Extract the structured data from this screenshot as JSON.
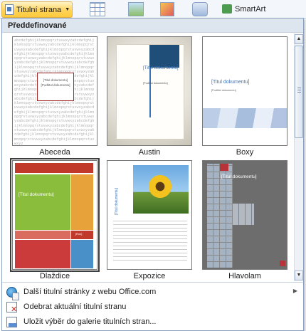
{
  "ribbon": {
    "cover_page_button": "Titulní strana",
    "smartart_label": "SmartArt"
  },
  "gallery": {
    "section_header": "Předdefinované",
    "tiles": [
      {
        "name": "Abeceda",
        "preview_title": "[Titul dokumentu]",
        "preview_sub": "[Podtitul dokumentu]",
        "preview_text": "abcdefghijklmnopqrstuvwxyz"
      },
      {
        "name": "Austin",
        "preview_title": "[Titul dokumentu]",
        "preview_sub": "[Podtitul dokumentu]"
      },
      {
        "name": "Boxy",
        "preview_title": "[Titul dokumentu]",
        "preview_sub": "[Podtitul dokumentu]"
      },
      {
        "name": "Dlaždice",
        "preview_title": "[Titul dokumentu]",
        "preview_year": "[Rok]"
      },
      {
        "name": "Expozice",
        "preview_title": "[Titul dokumentu]"
      },
      {
        "name": "Hlavolam",
        "preview_title": "[Titul dokumentu]"
      }
    ]
  },
  "menu": {
    "items": [
      {
        "label": "Další titulní stránky z webu Office.com",
        "has_submenu": true,
        "icon": "globe-icon"
      },
      {
        "label": "Odebrat aktuální titulní stranu",
        "has_submenu": false,
        "icon": "remove-cover-icon"
      },
      {
        "label": "Uložit výběr do galerie titulních stran...",
        "has_submenu": false,
        "icon": "save-to-gallery-icon"
      }
    ]
  },
  "colors": {
    "accent_blue": "#3b73b9",
    "ribbon_highlight": "#ffd35a",
    "header_bg": "#dde5ef"
  }
}
